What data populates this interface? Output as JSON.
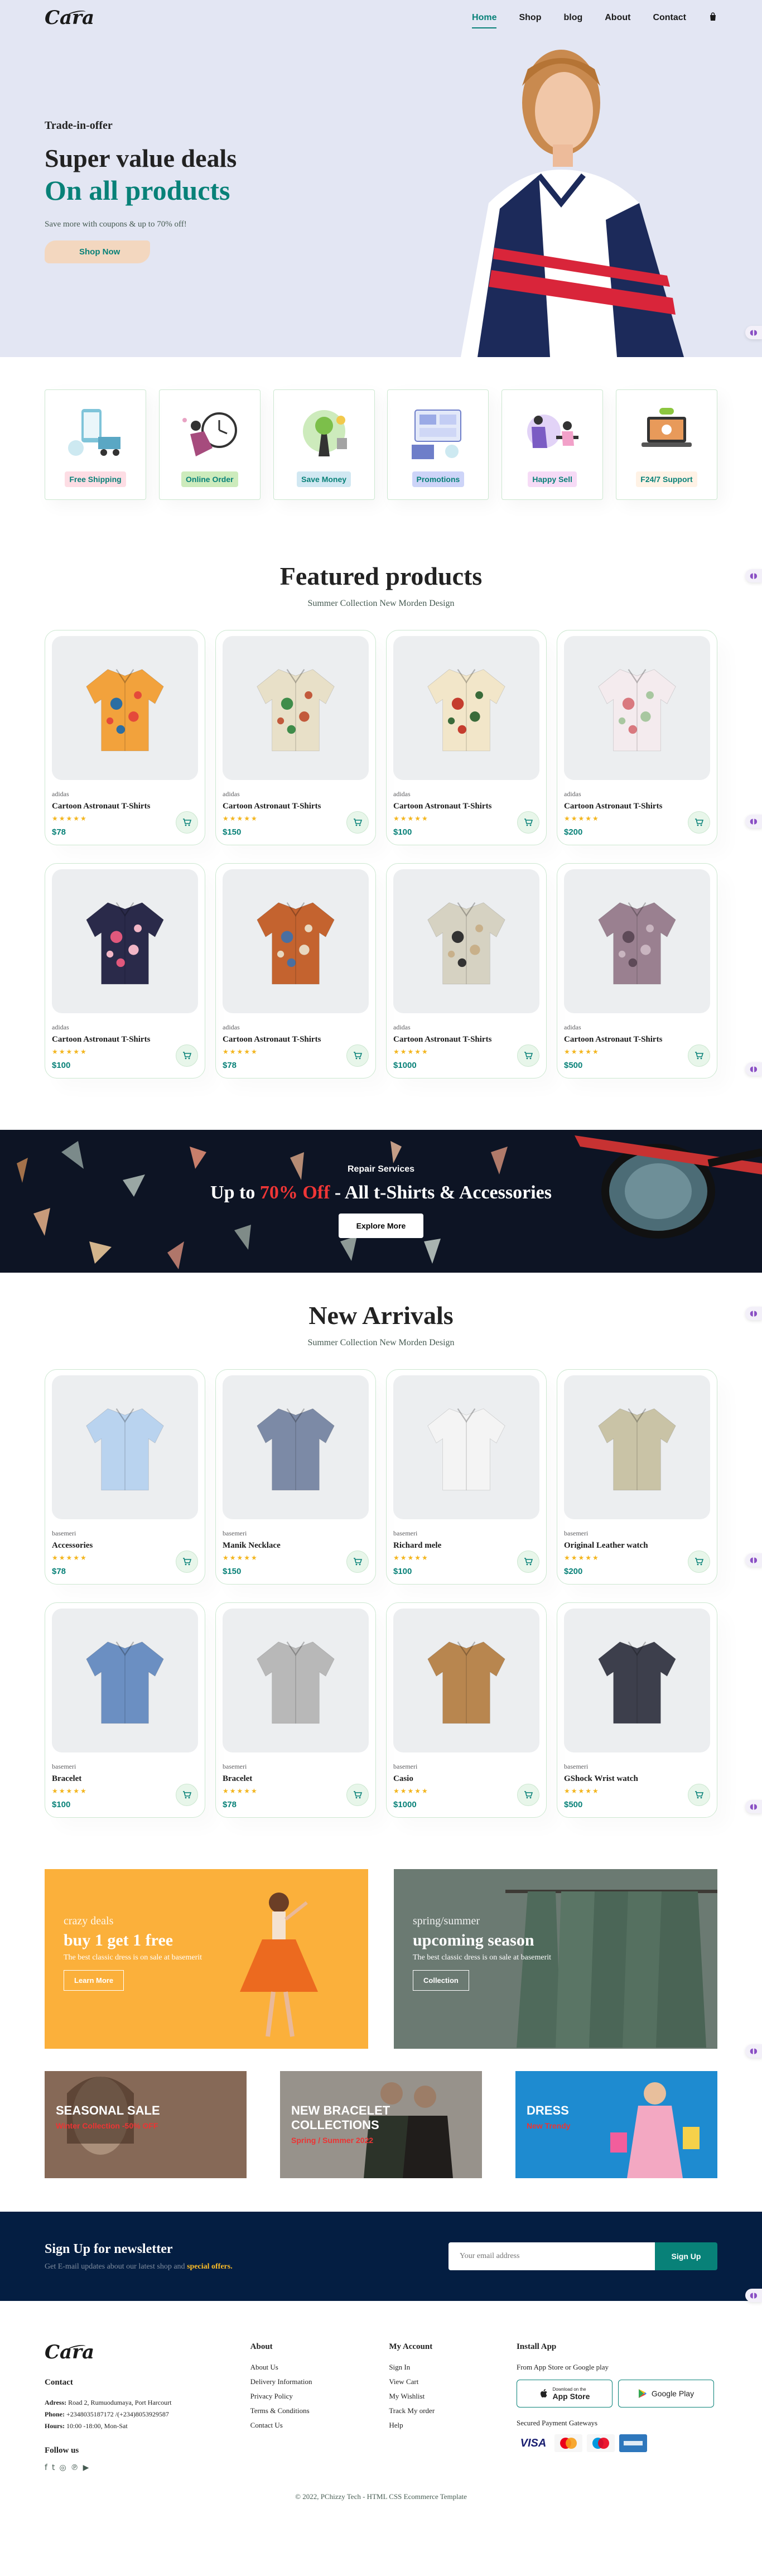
{
  "header": {
    "logo": "Cara",
    "nav": [
      {
        "label": "Home",
        "active": true
      },
      {
        "label": "Shop"
      },
      {
        "label": "blog"
      },
      {
        "label": "About"
      },
      {
        "label": "Contact"
      }
    ],
    "bag_icon": "shopping-bag-icon"
  },
  "hero": {
    "eyebrow": "Trade-in-offer",
    "title": "Super value deals",
    "highlight": "On all products",
    "subtitle": "Save more with coupons & up to 70% off!",
    "cta": "Shop Now"
  },
  "features": [
    {
      "label": "Free Shipping",
      "bg": "#fddde4"
    },
    {
      "label": "Online Order",
      "bg": "#cdebbc"
    },
    {
      "label": "Save Money",
      "bg": "#d1e8f2"
    },
    {
      "label": "Promotions",
      "bg": "#cdd4f8"
    },
    {
      "label": "Happy Sell",
      "bg": "#f6dbf6"
    },
    {
      "label": "F24/7 Support",
      "bg": "#fff2e5"
    }
  ],
  "featured": {
    "title": "Featured products",
    "subtitle": "Summer Collection New Morden Design",
    "products": [
      {
        "brand": "adidas",
        "name": "Cartoon Astronaut T-Shirts",
        "price": "$78",
        "stars": "★★★★★",
        "rating": 5
      },
      {
        "brand": "adidas",
        "name": "Cartoon Astronaut T-Shirts",
        "price": "$150",
        "stars": "★★★★★",
        "rating": 5
      },
      {
        "brand": "adidas",
        "name": "Cartoon Astronaut T-Shirts",
        "price": "$100",
        "stars": "★★★★★",
        "rating": 5
      },
      {
        "brand": "adidas",
        "name": "Cartoon Astronaut T-Shirts",
        "price": "$200",
        "stars": "★★★★★",
        "rating": 5
      },
      {
        "brand": "adidas",
        "name": "Cartoon Astronaut T-Shirts",
        "price": "$100",
        "stars": "★★★★★",
        "rating": 5
      },
      {
        "brand": "adidas",
        "name": "Cartoon Astronaut T-Shirts",
        "price": "$78",
        "stars": "★★★★★",
        "rating": 5
      },
      {
        "brand": "adidas",
        "name": "Cartoon Astronaut T-Shirts",
        "price": "$1000",
        "stars": "★★★★★",
        "rating": 5
      },
      {
        "brand": "adidas",
        "name": "Cartoon Astronaut T-Shirts",
        "price": "$500",
        "stars": "★★★★★",
        "rating": 5
      }
    ]
  },
  "banner": {
    "eyebrow": "Repair Services",
    "title_pre": "Up to ",
    "title_highlight": "70% Off",
    "title_post": " - All t-Shirts & Accessories",
    "cta": "Explore More"
  },
  "arrivals": {
    "title": "New Arrivals",
    "subtitle": "Summer Collection New Morden Design",
    "products": [
      {
        "brand": "basemeri",
        "name": "Accessories",
        "price": "$78",
        "stars": "★★★★★",
        "rating": 5
      },
      {
        "brand": "basemeri",
        "name": "Manik Necklace",
        "price": "$150",
        "stars": "★★★★★",
        "rating": 5
      },
      {
        "brand": "basemeri",
        "name": "Richard mele",
        "price": "$100",
        "stars": "★★★★★",
        "rating": 5
      },
      {
        "brand": "basemeri",
        "name": "Original Leather watch",
        "price": "$200",
        "stars": "★★★★★",
        "rating": 5
      },
      {
        "brand": "basemeri",
        "name": "Bracelet",
        "price": "$100",
        "stars": "★★★★★",
        "rating": 5
      },
      {
        "brand": "basemeri",
        "name": "Bracelet",
        "price": "$78",
        "stars": "★★★★★",
        "rating": 5
      },
      {
        "brand": "basemeri",
        "name": "Casio",
        "price": "$1000",
        "stars": "★★★★★",
        "rating": 5
      },
      {
        "brand": "basemeri",
        "name": "GShock Wrist watch",
        "price": "$500",
        "stars": "★★★★★",
        "rating": 5
      }
    ]
  },
  "promo": [
    {
      "eyebrow": "crazy deals",
      "title": "buy 1 get 1 free",
      "text": "The best classic dress is on sale at basemerit",
      "cta": "Learn More"
    },
    {
      "eyebrow": "spring/summer",
      "title": "upcoming season",
      "text": "The best classic dress is on sale at basemerit",
      "cta": "Collection"
    }
  ],
  "banner3": [
    {
      "title": "SEASONAL SALE",
      "sub": "Winter Collection -50% OFF"
    },
    {
      "title": "NEW BRACELET COLLECTIONS",
      "sub": "Spring / Summer 2022"
    },
    {
      "title": "DRESS",
      "sub": "New Trendy"
    }
  ],
  "newsletter": {
    "title": "Sign Up for newsletter",
    "text_pre": "Get E-mail updates about our latest shop and ",
    "text_highlight": "special offers.",
    "placeholder": "Your email address",
    "cta": "Sign Up"
  },
  "footer": {
    "logo": "Cara",
    "contact_title": "Contact",
    "address_label": "Adress:",
    "address": "Road 2, Rumuodumaya, Port Harcourt",
    "phone_label": "Phone:",
    "phone": "+2348035187172 /(+234)8053929587",
    "hours_label": "Hours:",
    "hours": "10:00 -18:00, Mon-Sat",
    "follow": "Follow us",
    "social": [
      "facebook-icon",
      "twitter-icon",
      "instagram-icon",
      "pinterest-icon",
      "youtube-icon"
    ],
    "about_title": "About",
    "about_links": [
      "About Us",
      "Delivery Information",
      "Privacy Policy",
      "Terms & Conditions",
      "Contact Us"
    ],
    "account_title": "My Account",
    "account_links": [
      "Sign In",
      "View Cart",
      "My Wishlist",
      "Track My order",
      "Help"
    ],
    "install_title": "Install App",
    "install_text": "From App Store or Google play",
    "appstore_small": "Download on the",
    "appstore": "App Store",
    "googleplay": "Google Play",
    "payments_text": "Secured Payment Gateways",
    "cards": [
      "VISA",
      "mastercard",
      "Maestro",
      "AMEX"
    ],
    "copyright": "© 2022, PChizzy Tech - HTML CSS Ecommerce Template"
  },
  "colors": {
    "accent": "#088178",
    "hero_bg": "#e3e6f3",
    "newsletter_bg": "#041e42",
    "banner_bg": "#0d1424",
    "sale_red": "#ef3636"
  }
}
